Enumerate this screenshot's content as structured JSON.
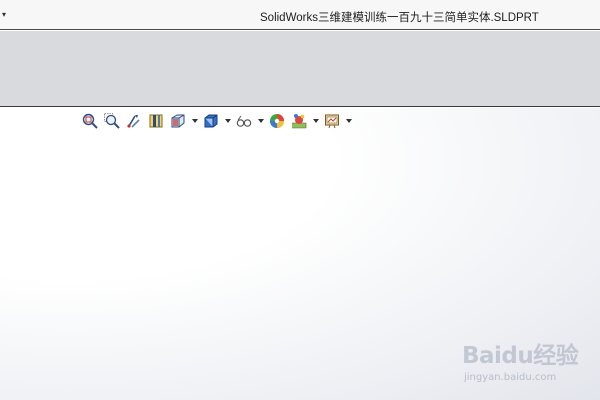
{
  "titlebar": {
    "menu_caret": "▾",
    "document_title": "SolidWorks三维建模训练一百九十三简单实体.SLDPRT"
  },
  "view_toolbar": {
    "buttons": [
      {
        "name": "zoom-to-fit",
        "icon": "zoom-to-fit-icon",
        "has_dropdown": false
      },
      {
        "name": "zoom-to-area",
        "icon": "zoom-to-area-icon",
        "has_dropdown": false
      },
      {
        "name": "previous-view",
        "icon": "previous-view-icon",
        "has_dropdown": false
      },
      {
        "name": "section-view",
        "icon": "section-view-icon",
        "has_dropdown": false
      },
      {
        "name": "view-orientation",
        "icon": "view-orientation-icon",
        "has_dropdown": true
      },
      {
        "name": "display-style",
        "icon": "display-style-icon",
        "has_dropdown": true
      },
      {
        "name": "hide-show-items",
        "icon": "hide-show-items-icon",
        "has_dropdown": true
      },
      {
        "name": "edit-appearance",
        "icon": "edit-appearance-icon",
        "has_dropdown": false
      },
      {
        "name": "apply-scene",
        "icon": "apply-scene-icon",
        "has_dropdown": true
      },
      {
        "name": "view-settings",
        "icon": "view-settings-icon",
        "has_dropdown": true
      }
    ]
  },
  "watermark": {
    "logo_text": "Baidu经验",
    "url_text": "jingyan.baidu.com"
  },
  "colors": {
    "titlebar_bg": "#f7f7f8",
    "ribbon_bg": "#d9dadd",
    "viewport_center": "#ffffff",
    "viewport_edge": "#e3e5ec"
  }
}
